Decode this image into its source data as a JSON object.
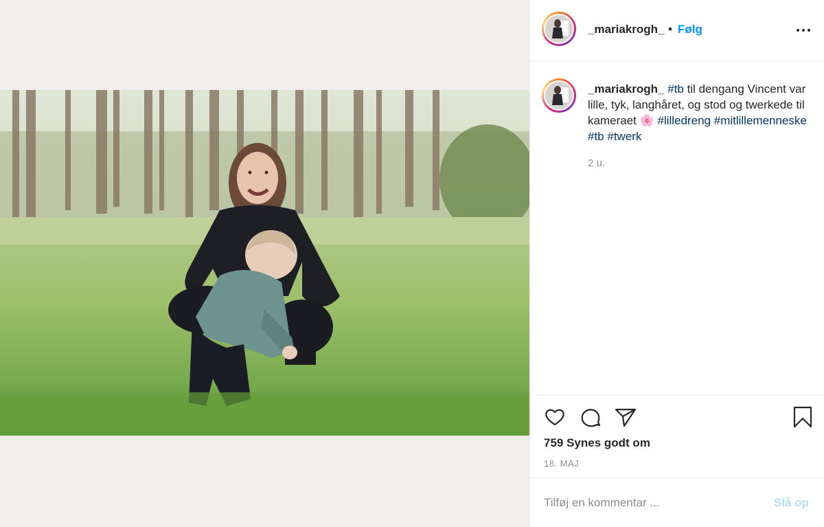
{
  "post": {
    "username": "_mariakrogh_",
    "separator": "•",
    "follow_label": "Følg",
    "more_icon": "more-horizontal-icon",
    "caption": {
      "username": "_mariakrogh_",
      "tag_tb": "#tb",
      "text_1": " til dengang Vincent var lille, tyk, langhåret, og stod og twerkede til kameraet ",
      "flower": "🌸",
      "tag_lilledreng": "#lilledreng",
      "tag_mitlillemenneske": "#mitlillemenneske",
      "tag_tb2": "#tb",
      "tag_twerk": "#twerk"
    },
    "time_ago": "2 u.",
    "actions": {
      "like_icon": "heart-icon",
      "comment_icon": "comment-icon",
      "share_icon": "share-icon",
      "save_icon": "bookmark-icon"
    },
    "likes_label": "759 Synes godt om",
    "date": "18. MAJ",
    "comment": {
      "placeholder": "Tilføj en kommentar ...",
      "post_label": "Slå op"
    }
  },
  "colors": {
    "link_blue": "#0095f6",
    "hashtag_blue": "#00376b",
    "muted_gray": "#8e8e8e",
    "disabled_blue": "#b2dffc"
  }
}
